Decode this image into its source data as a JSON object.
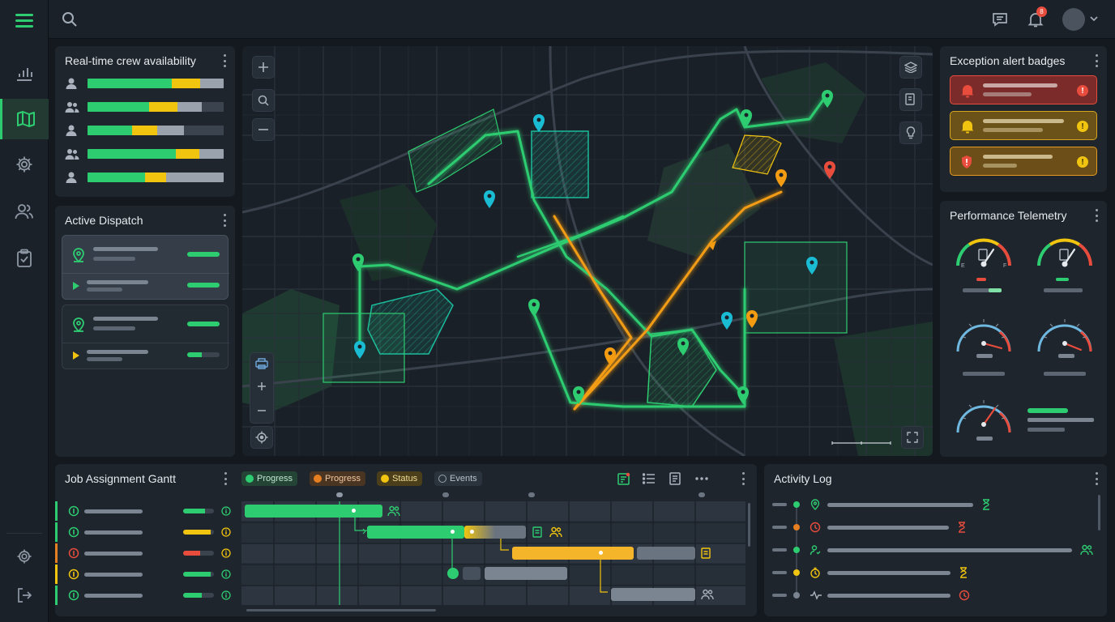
{
  "topbar": {
    "notification_count": "8",
    "icons": [
      "hamburger-menu-icon",
      "search-icon",
      "chat-icon",
      "bell-icon",
      "avatar",
      "chevron-down-icon"
    ]
  },
  "sidebar": {
    "items": [
      "analytics-icon",
      "map-icon",
      "gear-icon",
      "team-icon",
      "clipboard-icon",
      "settings-icon",
      "logout-icon"
    ],
    "active": "map-icon"
  },
  "crew_panel": {
    "title": "Real-time crew availability",
    "rows": [
      {
        "icon": "user-icon",
        "green": 0.62,
        "yellow": 0.21,
        "gray": 0.17
      },
      {
        "icon": "users-icon",
        "green": 0.45,
        "yellow": 0.21,
        "gray": 0.18
      },
      {
        "icon": "user-icon",
        "green": 0.33,
        "yellow": 0.18,
        "gray": 0.2
      },
      {
        "icon": "users-icon",
        "green": 0.65,
        "yellow": 0.17,
        "gray": 0.18
      },
      {
        "icon": "user-icon",
        "green": 0.42,
        "yellow": 0.16,
        "gray": 0.42
      }
    ]
  },
  "dispatch_panel": {
    "title": "Active Dispatch"
  },
  "alerts_panel": {
    "title": "Exception alert badges",
    "colors": {
      "critical": "#e74c3c",
      "warning": "#f1c40f",
      "security": "#f39c12"
    }
  },
  "telemetry_panel": {
    "title": "Performance Telemetry"
  },
  "gantt_panel": {
    "title": "Job Assignment Gantt",
    "chips": [
      {
        "label": "Progress",
        "color": "#2ecc71"
      },
      {
        "label": "Progress",
        "color": "#e67e22"
      },
      {
        "label": "Status",
        "color": "#f1c40f"
      },
      {
        "label": "Events",
        "color": "#95a5a6"
      }
    ]
  },
  "activity_panel": {
    "title": "Activity Log"
  },
  "colors": {
    "accent_green": "#2ecc71",
    "route_orange": "#f39c12",
    "alert_red": "#e74c3c",
    "warning_yellow": "#f1c40f",
    "teal": "#1abc9c"
  }
}
